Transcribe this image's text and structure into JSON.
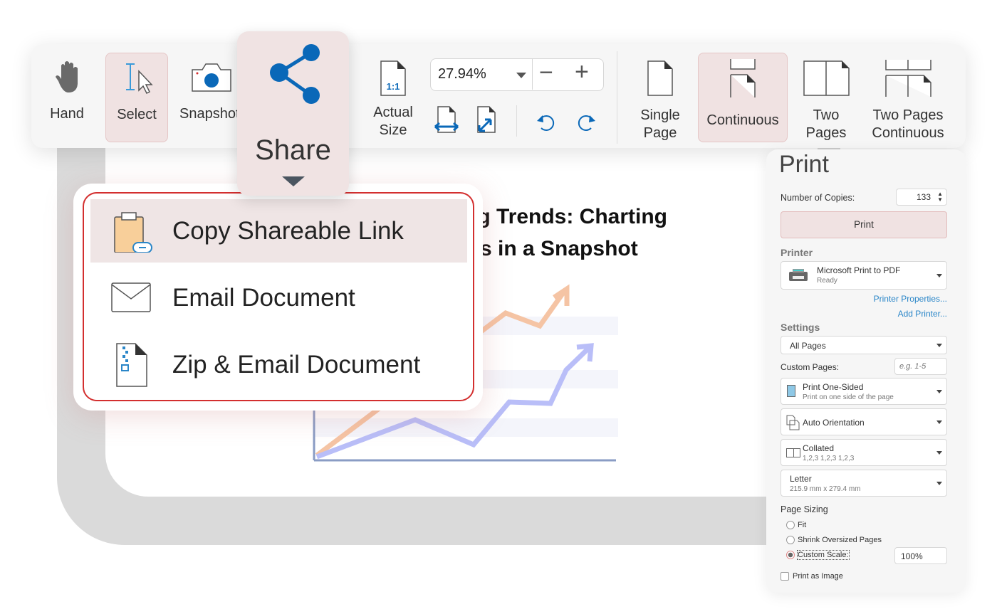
{
  "toolbar": {
    "hand": "Hand",
    "select": "Select",
    "snapshot": "Snapshot",
    "share": "Share",
    "actual_size": [
      "Actual",
      "Size"
    ],
    "zoom_value": "27.94%",
    "zoom_minus": "−",
    "zoom_plus": "+",
    "actual_size_icon_text": "1:1",
    "single_page": [
      "Single",
      "Page"
    ],
    "continuous": "Continuous",
    "two_pages": [
      "Two",
      "Pages"
    ],
    "two_pages_continuous": [
      "Two Pages",
      "Continuous"
    ]
  },
  "document": {
    "title_line1": "ng Trends: Charting",
    "title_line2": "s in a Snapshot"
  },
  "share_menu": {
    "items": [
      {
        "label": "Copy Shareable Link",
        "icon": "clipboard-link-icon",
        "highlighted": true
      },
      {
        "label": "Email Document",
        "icon": "envelope-icon"
      },
      {
        "label": "Zip & Email Document",
        "icon": "zip-file-icon"
      }
    ]
  },
  "print": {
    "title": "Print",
    "copies_label": "Number of Copies:",
    "copies_value": "133",
    "print_button": "Print",
    "printer_heading": "Printer",
    "printer_name": "Microsoft Print to PDF",
    "printer_status": "Ready",
    "printer_properties": "Printer Properties...",
    "add_printer": "Add Printer...",
    "settings_heading": "Settings",
    "pages_select": "All Pages",
    "custom_pages_label": "Custom Pages:",
    "custom_pages_placeholder": "e.g. 1-5",
    "sided": "Print One-Sided",
    "sided_sub": "Print on one side of the page",
    "orientation": "Auto Orientation",
    "collated": "Collated",
    "collated_sub": "1,2,3 1,2,3 1,2,3",
    "paper": "Letter",
    "paper_sub": "215.9 mm x 279.4 mm",
    "page_sizing": "Page Sizing",
    "fit": "Fit",
    "shrink": "Shrink Oversized Pages",
    "custom_scale": "Custom Scale:",
    "custom_scale_value": "100%",
    "selected_sizing": "Custom Scale",
    "print_as_image": "Print as Image",
    "print_as_image_checked": false
  },
  "colors": {
    "accent_blue": "#0a68b8",
    "highlight": "#f0e2e2",
    "menu_border": "#d32f2f",
    "link": "#2a86c8"
  }
}
